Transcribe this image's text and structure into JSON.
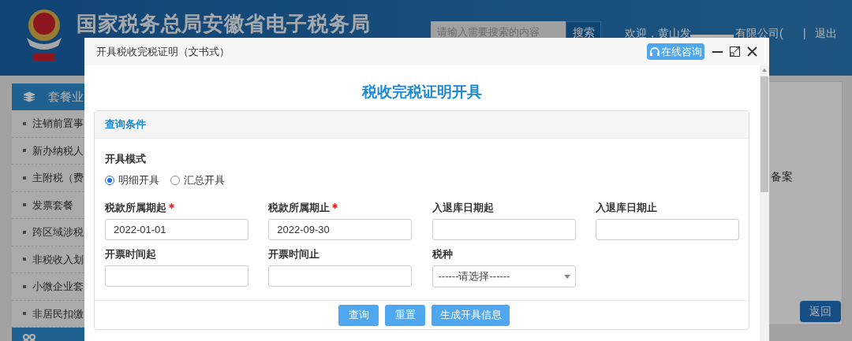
{
  "header": {
    "site_title": "国家税务总局安徽省电子税务局",
    "search": {
      "placeholder": "请输入需要搜索的内容",
      "button": "搜索"
    },
    "welcome": "欢迎，黄山发",
    "company": "有限公司(",
    "logout_separator": "|",
    "logout": "退出"
  },
  "sidebar": {
    "sections": [
      {
        "title": "套餐业",
        "items": [
          "注销前置事",
          "新办纳税人",
          "主附税（费",
          "发票套餐",
          "跨区域涉税",
          "非税收入划",
          "小微企业套",
          "非居民扣缴"
        ]
      }
    ]
  },
  "background_card": {
    "text": "备案",
    "button": "返回"
  },
  "dialog": {
    "title": "开具税收完税证明（文书式）",
    "consult_button": "在线咨询",
    "heading": "税收完税证明开具",
    "panel_title": "查询条件",
    "mode_label": "开具模式",
    "modes": [
      {
        "label": "明细开具",
        "selected": true
      },
      {
        "label": "汇总开具",
        "selected": false
      }
    ],
    "fields": [
      {
        "kind": "input",
        "label": "税款所属期起",
        "required": true,
        "value": "2022-01-01"
      },
      {
        "kind": "input",
        "label": "税款所属期止",
        "required": true,
        "value": "2022-09-30"
      },
      {
        "kind": "input",
        "label": "入退库日期起",
        "required": false
      },
      {
        "kind": "input",
        "label": "入退库日期止",
        "required": false
      },
      {
        "kind": "input",
        "label": "开票时间起",
        "required": false
      },
      {
        "kind": "input",
        "label": "开票时间止",
        "required": false
      },
      {
        "kind": "select",
        "label": "税种",
        "required": false,
        "value": "------请选择------"
      }
    ],
    "buttons": [
      "查询",
      "重置",
      "生成开具信息"
    ]
  }
}
